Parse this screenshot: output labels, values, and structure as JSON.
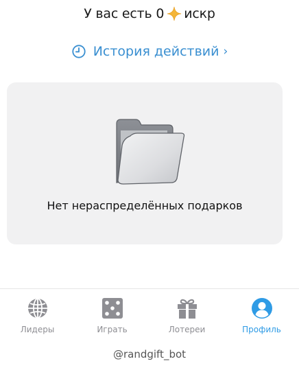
{
  "balance": {
    "prefix": "У вас есть 0",
    "currency": "искр",
    "icon": "sparkle-icon",
    "icon_color": "#f4b63a"
  },
  "history": {
    "label": "История действий",
    "chevron": "›",
    "icon": "clock-icon",
    "color": "#3a8fd1"
  },
  "empty_state": {
    "icon": "empty-folder-icon",
    "message": "Нет нераспределённых подарков"
  },
  "nav": {
    "items": [
      {
        "label": "Лидеры",
        "icon": "globe-icon",
        "active": false
      },
      {
        "label": "Играть",
        "icon": "dice-icon",
        "active": false
      },
      {
        "label": "Лотереи",
        "icon": "gift-icon",
        "active": false
      },
      {
        "label": "Профиль",
        "icon": "profile-icon",
        "active": true
      }
    ],
    "inactive_color": "#8e8e93",
    "active_color": "#2f9be5"
  },
  "footer": {
    "bot_handle": "@randgift_bot"
  }
}
